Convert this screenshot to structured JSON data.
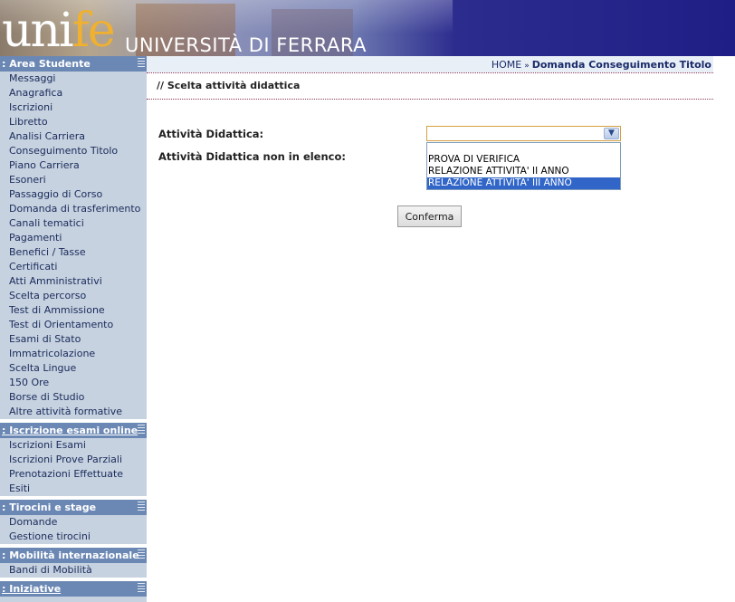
{
  "header": {
    "logo_part1": "uni",
    "logo_part2": "fe",
    "logo_text": "UNIVERSITÀ DI FERRARA"
  },
  "sidebar": {
    "sections": [
      {
        "title": "Area Studente",
        "items": [
          "Messaggi",
          "Anagrafica",
          "Iscrizioni",
          "Libretto",
          "Analisi Carriera",
          "Conseguimento Titolo",
          "Piano Carriera",
          "Esoneri",
          "Passaggio di Corso",
          "Domanda di trasferimento",
          "Canali tematici",
          "Pagamenti",
          "Benefici / Tasse",
          "Certificati",
          "Atti Amministrativi",
          "Scelta percorso",
          "Test di Ammissione",
          "Test di Orientamento",
          "Esami di Stato",
          "Immatricolazione",
          "Scelta Lingue",
          "150 Ore",
          "Borse di Studio",
          "Altre attività formative"
        ]
      },
      {
        "title": "Iscrizione esami online",
        "items": [
          "Iscrizioni Esami",
          "Iscrizioni Prove Parziali",
          "Prenotazioni Effettuate",
          "Esiti"
        ]
      },
      {
        "title": "Tirocini e stage",
        "items": [
          "Domande",
          "Gestione tirocini"
        ]
      },
      {
        "title": "Mobilità internazionale",
        "items": [
          "Bandi di Mobilità"
        ]
      },
      {
        "title": "Iniziative",
        "items": []
      }
    ]
  },
  "breadcrumb": {
    "home": "HOME",
    "separator": "»",
    "current": "Domanda Conseguimento Titolo"
  },
  "page_title": "// Scelta attività didattica",
  "form": {
    "label_activity": "Attività Didattica:",
    "label_activity_other": "Attività Didattica non in elenco:",
    "select_value": "",
    "options": [
      "",
      "PROVA DI VERIFICA",
      "RELAZIONE ATTIVITA' II ANNO",
      "RELAZIONE ATTIVITA' III ANNO"
    ],
    "highlighted_option": "RELAZIONE ATTIVITA' III ANNO",
    "confirm_label": "Conferma"
  },
  "colors": {
    "sidebar_bg": "#c6d2e0",
    "section_header": "#6b88b4",
    "nav_text": "#1a2a5a",
    "selection": "#3166c8",
    "select_border": "#d4a040"
  }
}
